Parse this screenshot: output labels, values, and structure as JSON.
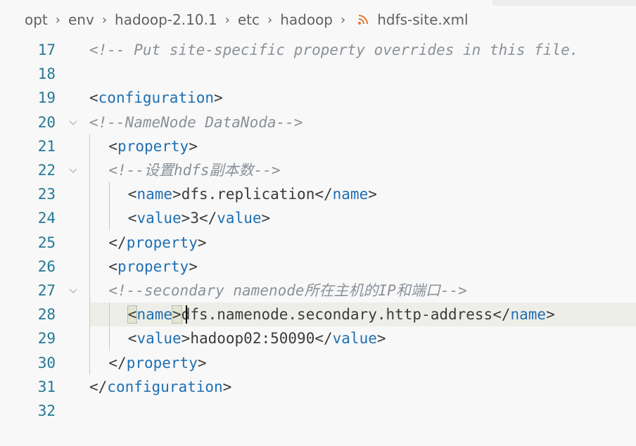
{
  "breadcrumb": {
    "segments": [
      "opt",
      "env",
      "hadoop-2.10.1",
      "etc",
      "hadoop"
    ],
    "file": "hdfs-site.xml",
    "separator": "›"
  },
  "icons": {
    "file_icon": "rss-icon",
    "fold_icon": "chevron-down-icon"
  },
  "colors": {
    "line_number": "#237893",
    "tag": "#1e6fb3",
    "comment": "#8a9198",
    "file_icon": "#e37933"
  },
  "editor": {
    "lines": [
      {
        "num": "17",
        "comment": "<!-- Put site-specific property overrides in this file."
      },
      {
        "num": "18"
      },
      {
        "num": "19",
        "open": "<",
        "tag": "configuration",
        "close": ">"
      },
      {
        "num": "20",
        "comment": "<!--NameNode DataNoda-->",
        "fold": true
      },
      {
        "num": "21",
        "open": "<",
        "tag": "property",
        "close": ">"
      },
      {
        "num": "22",
        "comment": "<!--设置hdfs副本数-->",
        "fold": true
      },
      {
        "num": "23",
        "open": "<",
        "tag": "name",
        "close": ">",
        "text": "dfs.replication",
        "end_open": "</",
        "end_tag": "name",
        "end_close": ">"
      },
      {
        "num": "24",
        "open": "<",
        "tag": "value",
        "close": ">",
        "text": "3",
        "end_open": "</",
        "end_tag": "value",
        "end_close": ">"
      },
      {
        "num": "25",
        "open": "</",
        "tag": "property",
        "close": ">"
      },
      {
        "num": "26",
        "open": "<",
        "tag": "property",
        "close": ">"
      },
      {
        "num": "27",
        "comment": "<!--secondary namenode所在主机的IP和端口-->",
        "fold": true
      },
      {
        "num": "28",
        "open": "<",
        "tag": "name",
        "close": ">",
        "text": "dfs.namenode.secondary.http-address",
        "end_open": "</",
        "end_tag": "name",
        "end_close": ">"
      },
      {
        "num": "29",
        "open": "<",
        "tag": "value",
        "close": ">",
        "text": "hadoop02:50090",
        "end_open": "</",
        "end_tag": "value",
        "end_close": ">"
      },
      {
        "num": "30",
        "open": "</",
        "tag": "property",
        "close": ">"
      },
      {
        "num": "31",
        "open": "</",
        "tag": "configuration",
        "close": ">"
      },
      {
        "num": "32"
      }
    ]
  }
}
